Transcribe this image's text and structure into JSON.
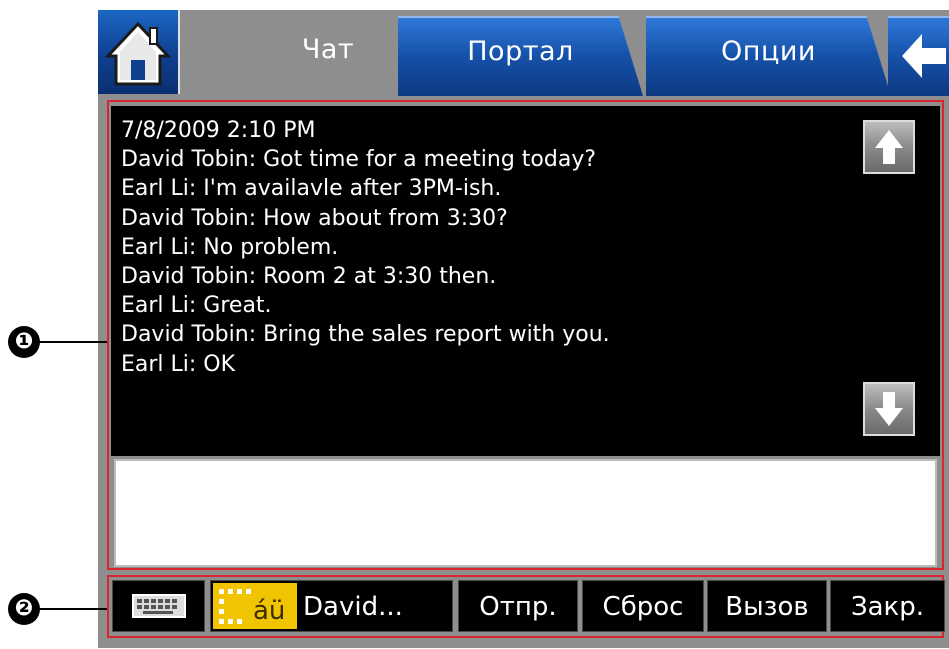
{
  "tabs": [
    {
      "label": "Чат",
      "active": true
    },
    {
      "label": "Портал",
      "active": false
    },
    {
      "label": "Опции",
      "active": false
    }
  ],
  "icons": {
    "home": "home-icon",
    "back": "back-arrow-icon",
    "scroll_up": "arrow-up-icon",
    "scroll_down": "arrow-down-icon",
    "keyboard": "keyboard-icon",
    "contact": "contact-list-icon"
  },
  "chat": {
    "messages": [
      "7/8/2009 2:10 PM",
      "David Tobin: Got time for a meeting today?",
      "Earl Li: I'm availavle after 3PM-ish.",
      "David Tobin: How about from 3:30?",
      "Earl Li: No problem.",
      "David Tobin: Room 2 at 3:30 then.",
      "Earl Li: Great.",
      "David Tobin: Bring the sales report with you.",
      "Earl Li: OK"
    ],
    "input_value": ""
  },
  "toolbar": {
    "contact_label": "David...",
    "send_label": "Отпр.",
    "reset_label": "Сброс",
    "call_label": "Вызов",
    "close_label": "Закр."
  },
  "callouts": {
    "one": "❶",
    "two": "❷"
  },
  "colors": {
    "tab_blue": "#1550a8",
    "highlight_frame": "#d9262e",
    "contact_icon": "#f0c400",
    "chat_background": "#000000"
  }
}
